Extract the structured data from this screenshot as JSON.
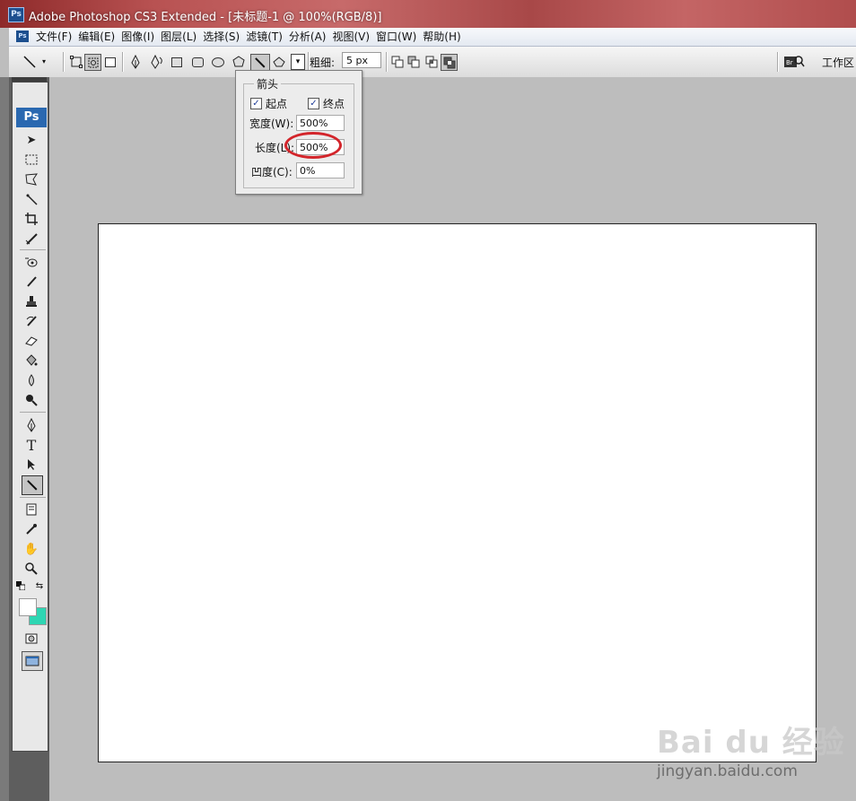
{
  "window": {
    "title": "Adobe Photoshop CS3 Extended - [未标题-1 @ 100%(RGB/8)]",
    "app_icon": "Ps"
  },
  "menu": {
    "icon": "Ps",
    "items": [
      "文件(F)",
      "编辑(E)",
      "图像(I)",
      "图层(L)",
      "选择(S)",
      "滤镜(T)",
      "分析(A)",
      "视图(V)",
      "窗口(W)",
      "帮助(H)"
    ]
  },
  "options": {
    "weight_label": "粗细:",
    "weight_value": "5 px",
    "workspace_label": "工作区"
  },
  "arrow_popup": {
    "legend": "箭头",
    "start_label": "起点",
    "start_checked": "✓",
    "end_label": "终点",
    "end_checked": "✓",
    "width_label": "宽度(W):",
    "width_value": "500%",
    "length_label": "长度(L):",
    "length_value": "500%",
    "concavity_label": "凹度(C):",
    "concavity_value": "0%"
  },
  "toolbox": {
    "grip": "▸▸",
    "logo": "Ps"
  },
  "watermark": {
    "logo": "Bai du 经验",
    "url": "jingyan.baidu.com"
  },
  "colors": {
    "foreground": "#ffffff",
    "background": "#2ed6b3",
    "highlight": "#d3252b"
  }
}
